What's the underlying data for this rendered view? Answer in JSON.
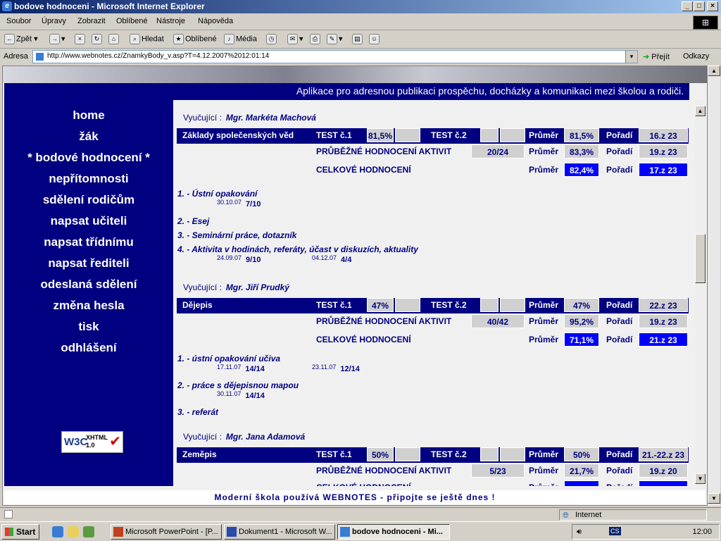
{
  "window": {
    "title": "bodove hodnoceni - Microsoft Internet Explorer"
  },
  "menu": [
    "Soubor",
    "Úpravy",
    "Zobrazit",
    "Oblíbené",
    "Nástroje",
    "Nápověda"
  ],
  "toolbar": {
    "back": "Zpět",
    "search": "Hledat",
    "favorites": "Oblíbené",
    "media": "Média"
  },
  "address": {
    "label": "Adresa",
    "url": "http://www.webnotes.cz/ZnamkyBody_v.asp?T=4.12.2007%2012:01:14",
    "go": "Přejít",
    "links": "Odkazy"
  },
  "header": "Aplikace pro adresnou publikaci prospěchu, docházky a komunikaci mezi školou a rodiči.",
  "nav": [
    "home",
    "žák",
    "* bodové hodnocení *",
    "nepřítomnosti",
    "sdělení rodičům",
    "napsat učiteli",
    "napsat třídnímu",
    "napsat řediteli",
    "odeslaná sdělení",
    "změna hesla",
    "tisk",
    "odhlášení"
  ],
  "w3c": {
    "logo": "W3C",
    "badge1": "XHTML",
    "badge2": "1.0"
  },
  "labels": {
    "teacher": "Vyučující :",
    "test1": "TEST č.1",
    "test2": "TEST č.2",
    "avg": "Průměr",
    "rank": "Pořadí",
    "continuous": "PRŮBĚŽNÉ HODNOCENÍ AKTIVIT",
    "overall": "CELKOVÉ HODNOCENÍ"
  },
  "subjects": [
    {
      "teacher": "Mgr. Markéta Machová",
      "name": "Základy společenských věd",
      "test1": "81,5%",
      "test2": "",
      "avg": "81,5%",
      "rank": "16.z 23",
      "cont_score": "20/24",
      "cont_avg": "83,3%",
      "cont_rank": "19.z 23",
      "total_avg": "82,4%",
      "total_rank": "17.z 23",
      "activities": [
        {
          "title": "1. - Ústní opakování",
          "grades": [
            {
              "date": "30.10.07",
              "score": "7/10"
            }
          ]
        },
        {
          "title": "2. - Esej",
          "grades": []
        },
        {
          "title": "3. - Seminární práce, dotazník",
          "grades": []
        },
        {
          "title": "4. - Aktivita v hodinách, referáty, účast v diskuzích, aktuality",
          "grades": [
            {
              "date": "24.09.07",
              "score": "9/10"
            },
            {
              "date": "04.12.07",
              "score": "4/4"
            }
          ]
        }
      ]
    },
    {
      "teacher": "Mgr. Jiří Prudký",
      "name": "Dějepis",
      "test1": "47%",
      "test2": "",
      "avg": "47%",
      "rank": "22.z 23",
      "cont_score": "40/42",
      "cont_avg": "95,2%",
      "cont_rank": "19.z 23",
      "total_avg": "71,1%",
      "total_rank": "21.z 23",
      "activities": [
        {
          "title": "1. - ústní opakování učiva",
          "grades": [
            {
              "date": "17.11.07",
              "score": "14/14"
            },
            {
              "date": "23.11.07",
              "score": "12/14"
            }
          ]
        },
        {
          "title": "2. - práce s dějepisnou mapou",
          "grades": [
            {
              "date": "30.11.07",
              "score": "14/14"
            }
          ]
        },
        {
          "title": "3. - referát",
          "grades": []
        }
      ]
    },
    {
      "teacher": "Mgr. Jana Adamová",
      "name": "Zeměpis",
      "test1": "50%",
      "test2": "",
      "avg": "50%",
      "rank": "21.-22.z 23",
      "cont_score": "5/23",
      "cont_avg": "21,7%",
      "cont_rank": "19.z 20",
      "total_avg": "",
      "total_rank": ""
    }
  ],
  "footer": "Moderní škola používá WEBNOTES - připojte se ještě dnes !",
  "status": {
    "zone": "Internet"
  },
  "taskbar": {
    "start": "Start",
    "tasks": [
      "Microsoft PowerPoint - [P...",
      "Dokument1 - Microsoft W...",
      "bodove hodnoceni - Mi..."
    ],
    "clock": "12:00"
  }
}
